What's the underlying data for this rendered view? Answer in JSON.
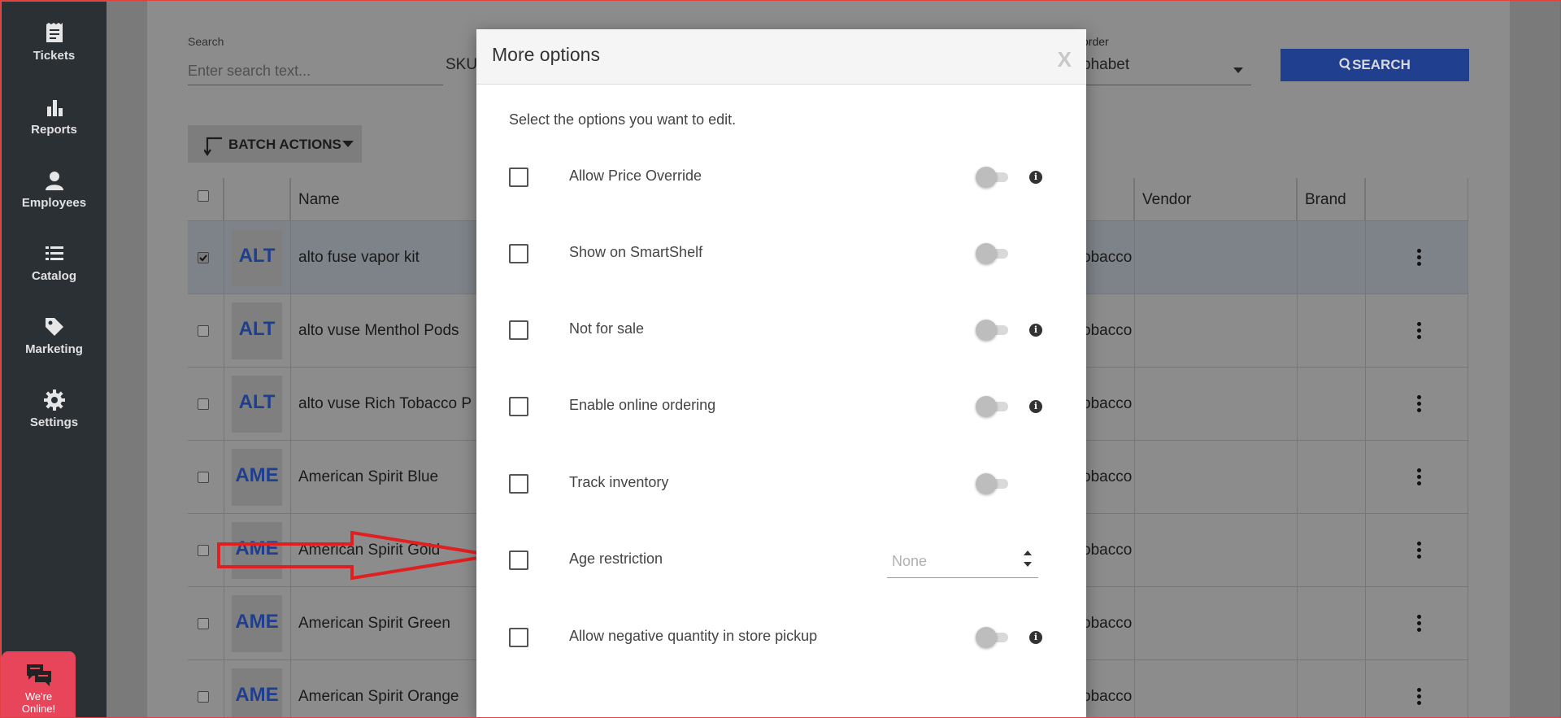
{
  "sidebar": {
    "items": [
      {
        "label": "Tickets",
        "icon": "tickets-icon"
      },
      {
        "label": "Reports",
        "icon": "bar-chart-icon"
      },
      {
        "label": "Employees",
        "icon": "person-icon"
      },
      {
        "label": "Catalog",
        "icon": "list-icon"
      },
      {
        "label": "Marketing",
        "icon": "tag-icon"
      },
      {
        "label": "Settings",
        "icon": "gear-icon"
      }
    ],
    "chat": {
      "label_line1": "We're",
      "label_line2": "Online!"
    }
  },
  "toolbar": {
    "search_label": "Search",
    "search_placeholder": "Enter search text...",
    "sku_label": "SKU",
    "sort_label": "order",
    "sort_value": "phabet",
    "search_button": "SEARCH",
    "batch_actions": "BATCH ACTIONS"
  },
  "table": {
    "headers": {
      "name": "Name",
      "vendor": "Vendor",
      "brand": "Brand"
    },
    "rows": [
      {
        "thumb": "ALT",
        "name": "alto fuse vapor kit",
        "category": "obacco",
        "selected": true
      },
      {
        "thumb": "ALT",
        "name": "alto vuse Menthol Pods",
        "category": "obacco",
        "selected": false
      },
      {
        "thumb": "ALT",
        "name": "alto vuse Rich Tobacco P",
        "category": "obacco",
        "selected": false
      },
      {
        "thumb": "AME",
        "name": "American Spirit Blue",
        "category": "obacco",
        "selected": false
      },
      {
        "thumb": "AME",
        "name": "American Spirit Gold",
        "category": "obacco",
        "selected": false
      },
      {
        "thumb": "AME",
        "name": "American Spirit Green",
        "category": "obacco",
        "selected": false
      },
      {
        "thumb": "AME",
        "name": "American Spirit Orange",
        "category": "obacco",
        "selected": false
      }
    ]
  },
  "modal": {
    "title": "More options",
    "close": "X",
    "intro": "Select the options you want to edit.",
    "options": [
      {
        "label": "Allow Price Override",
        "control": "toggle",
        "info": true
      },
      {
        "label": "Show on SmartShelf",
        "control": "toggle",
        "info": false
      },
      {
        "label": "Not for sale",
        "control": "toggle",
        "info": true
      },
      {
        "label": "Enable online ordering",
        "control": "toggle",
        "info": true
      },
      {
        "label": "Track inventory",
        "control": "toggle",
        "info": false
      },
      {
        "label": "Age restriction",
        "control": "select",
        "placeholder": "None"
      },
      {
        "label": "Allow negative quantity in store pickup",
        "control": "toggle",
        "info": true
      }
    ]
  },
  "colors": {
    "sidebar_bg": "#2b3035",
    "search_button": "#213f8f",
    "chat_button": "#e8455a",
    "annotation_arrow": "#e02020"
  }
}
